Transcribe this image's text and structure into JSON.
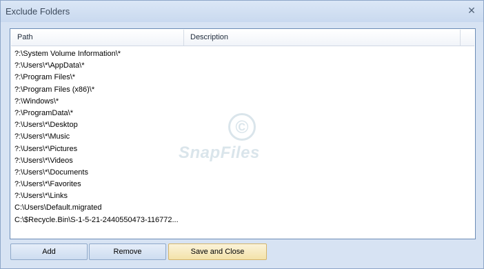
{
  "window": {
    "title": "Exclude Folders",
    "close_symbol": "✕"
  },
  "list": {
    "columns": [
      "Path",
      "Description"
    ],
    "rows": [
      "?:\\System Volume Information\\*",
      "?:\\Users\\*\\AppData\\*",
      "?:\\Program Files\\*",
      "?:\\Program Files (x86)\\*",
      "?:\\Windows\\*",
      "?:\\ProgramData\\*",
      "?:\\Users\\*\\Desktop",
      "?:\\Users\\*\\Music",
      "?:\\Users\\*\\Pictures",
      "?:\\Users\\*\\Videos",
      "?:\\Users\\*\\Documents",
      "?:\\Users\\*\\Favorites",
      "?:\\Users\\*\\Links",
      "C:\\Users\\Default.migrated",
      "C:\\$Recycle.Bin\\S-1-5-21-2440550473-116772..."
    ]
  },
  "watermark": {
    "symbol": "©",
    "text": "SnapFiles"
  },
  "buttons": {
    "add": "Add",
    "remove": "Remove",
    "save_close": "Save and Close"
  }
}
